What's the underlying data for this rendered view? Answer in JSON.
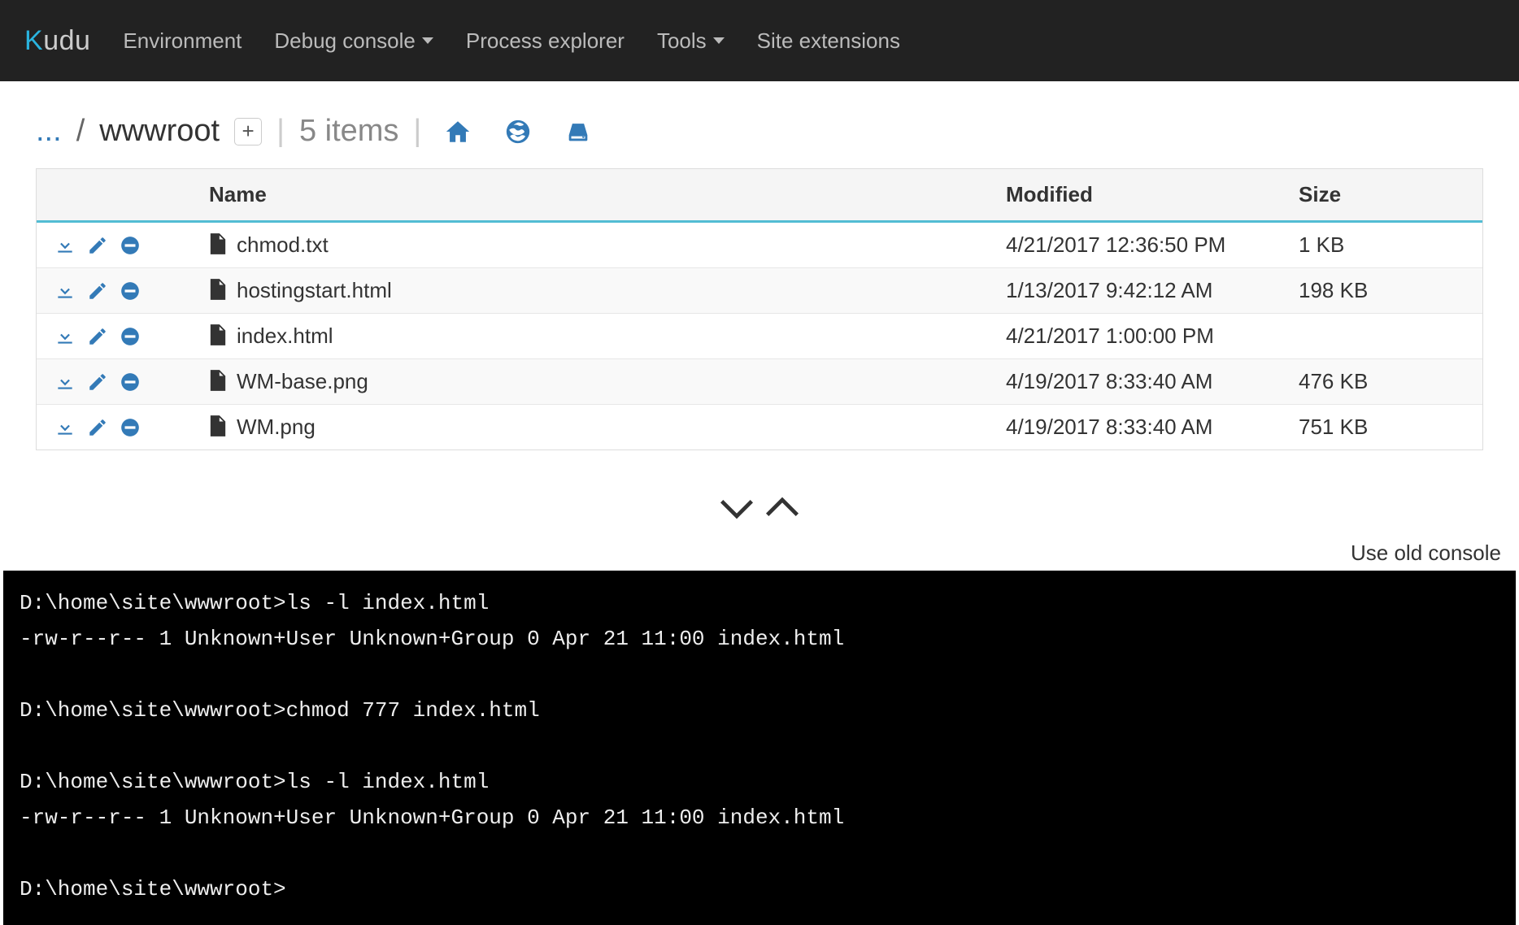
{
  "brand": {
    "first": "K",
    "rest": "udu"
  },
  "nav": {
    "environment": "Environment",
    "debug_console": "Debug console",
    "process_explorer": "Process explorer",
    "tools": "Tools",
    "site_extensions": "Site extensions"
  },
  "breadcrumb": {
    "dots": "...",
    "slash": "/",
    "current": "wwwroot",
    "add_label": "+",
    "separator": "|",
    "item_count_text": "5 items"
  },
  "toolbar_icons": {
    "home": "home-icon",
    "globe": "globe-icon",
    "disk": "disk-icon"
  },
  "table": {
    "headers": {
      "name": "Name",
      "modified": "Modified",
      "size": "Size"
    },
    "rows": [
      {
        "name": "chmod.txt",
        "modified": "4/21/2017 12:36:50 PM",
        "size": "1 KB"
      },
      {
        "name": "hostingstart.html",
        "modified": "1/13/2017 9:42:12 AM",
        "size": "198 KB"
      },
      {
        "name": "index.html",
        "modified": "4/21/2017 1:00:00 PM",
        "size": ""
      },
      {
        "name": "WM-base.png",
        "modified": "4/19/2017 8:33:40 AM",
        "size": "476 KB"
      },
      {
        "name": "WM.png",
        "modified": "4/19/2017 8:33:40 AM",
        "size": "751 KB"
      }
    ]
  },
  "old_console_link": "Use old console",
  "console": {
    "lines": [
      {
        "prompt": "D:\\home\\site\\wwwroot>",
        "cmd": "ls -l index.html"
      },
      {
        "out": "-rw-r--r-- 1 Unknown+User Unknown+Group 0 Apr 21 11:00 index.html"
      },
      {
        "out": ""
      },
      {
        "prompt": "D:\\home\\site\\wwwroot>",
        "cmd": "chmod 777 index.html"
      },
      {
        "out": ""
      },
      {
        "prompt": "D:\\home\\site\\wwwroot>",
        "cmd": "ls -l index.html"
      },
      {
        "out": "-rw-r--r-- 1 Unknown+User Unknown+Group 0 Apr 21 11:00 index.html"
      },
      {
        "out": ""
      },
      {
        "prompt": "D:\\home\\site\\wwwroot>",
        "cmd": ""
      }
    ]
  }
}
